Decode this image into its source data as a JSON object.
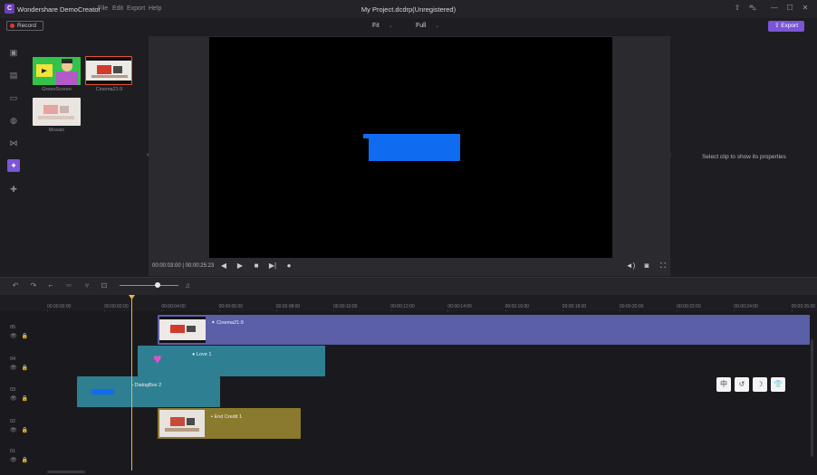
{
  "app": {
    "name": "Wondershare DemoCreator",
    "logo_letter": "C",
    "document_title": "My Project.dcdrp(Unregistered)",
    "menu": [
      "File",
      "Edit",
      "Export",
      "Help"
    ]
  },
  "toolbar": {
    "record_label": "Record",
    "fit_label": "Fit",
    "full_label": "Full",
    "export_label": "Export"
  },
  "media": {
    "items": [
      {
        "label": "GreenScreen"
      },
      {
        "label": "Cinema21:9"
      },
      {
        "label": "Mosaic"
      }
    ]
  },
  "preview": {
    "time_current": "00:00:03:00",
    "time_total": "00:00:25:23",
    "properties_message": "Select clip to show its properties"
  },
  "timeline": {
    "ruler_labels": [
      "00:00:00:00",
      "00:00:02:00",
      "00:00:04:00",
      "00:00:06:00",
      "00:00:08:00",
      "00:00:10:00",
      "00:00:12:00",
      "00:00:14:00",
      "00:00:16:00",
      "00:00:18:00",
      "00:00:20:00",
      "00:00:22:00",
      "00:00:24:00",
      "00:00:26:00"
    ],
    "tracks": [
      {
        "label": "05",
        "clip": "Cinema21:9"
      },
      {
        "label": "04",
        "clip": "Love 1"
      },
      {
        "label": "03",
        "clip": "DialogBox 2"
      },
      {
        "label": "02",
        "clip": "End Credit 1"
      },
      {
        "label": "01",
        "clip": ""
      }
    ]
  },
  "stickers": [
    "中",
    "↺",
    "☽",
    "👕"
  ],
  "colors": {
    "accent": "#7a56d6",
    "playhead": "#f2b233",
    "track5": "#5a5fa8",
    "track4": "#2f7f92",
    "track3": "#2f7f92",
    "track2": "#8a7a2e",
    "blue_shape": "#0f6cf0"
  }
}
